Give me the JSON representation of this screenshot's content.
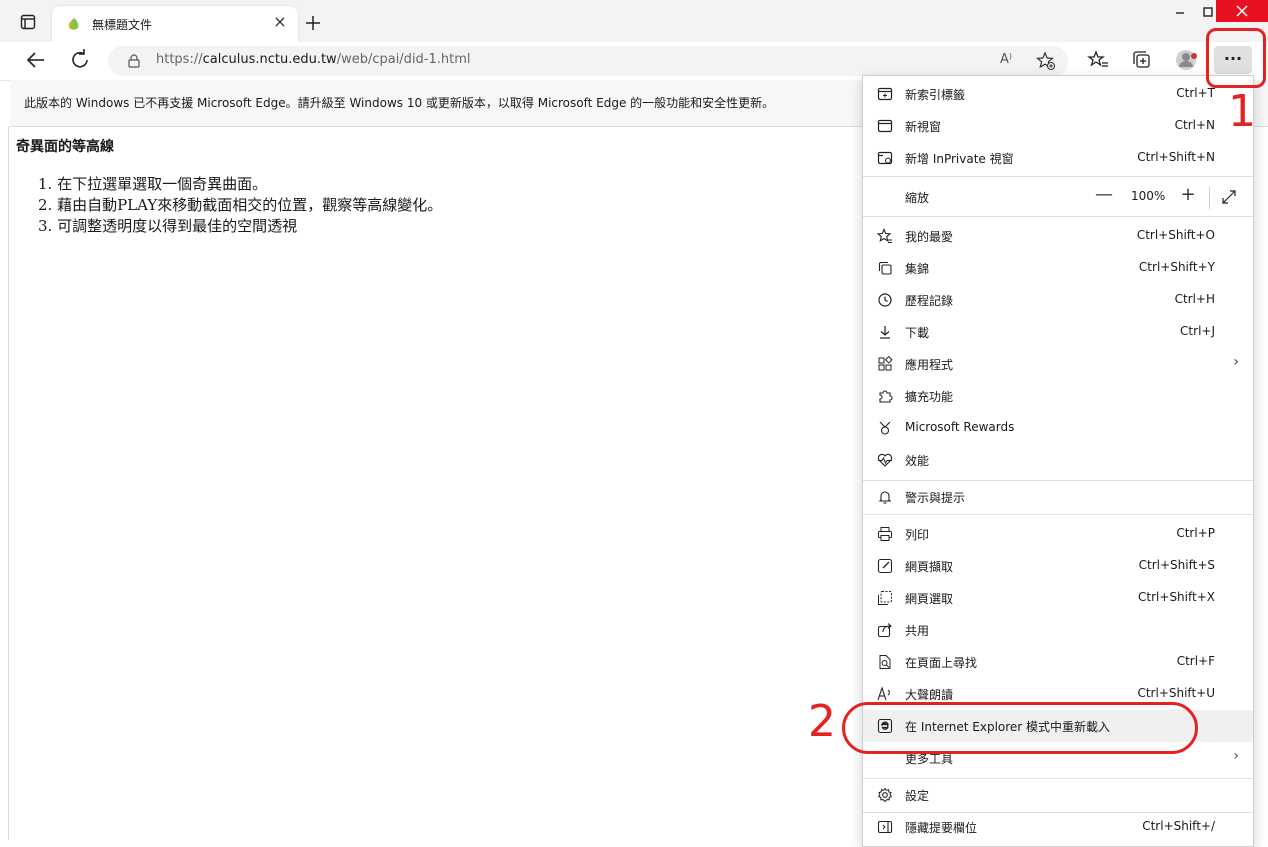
{
  "tab": {
    "title": "無標題文件",
    "close_glyph": "×"
  },
  "window": {
    "minimize_glyph": "−",
    "maximize_glyph": "□",
    "close_glyph": "✕"
  },
  "address": {
    "url_prefix": "https://",
    "url_domain": "calculus.nctu.edu.tw",
    "url_path": "/web/cpai/did-1.html",
    "read_aloud_glyph": "A⁾"
  },
  "menu_button": {
    "glyph": "···"
  },
  "infobar": {
    "text": "此版本的 Windows 已不再支援 Microsoft Edge。請升級至 Windows 10 或更新版本，以取得 Microsoft Edge 的一般功能和安全性更新。"
  },
  "page": {
    "heading": "奇異面的等高線",
    "steps": [
      "1. 在下拉選單選取一個奇異曲面。",
      "2. 藉由自動PLAY來移動截面相交的位置，觀察等高線變化。",
      "3. 可調整透明度以得到最佳的空間透視"
    ]
  },
  "menu": {
    "items": [
      {
        "label": "新索引標籤",
        "shortcut": "Ctrl+T"
      },
      {
        "label": "新視窗",
        "shortcut": "Ctrl+N"
      },
      {
        "label": "新增 InPrivate 視窗",
        "shortcut": "Ctrl+Shift+N"
      },
      {
        "label": "縮放",
        "zoom_value": "100%",
        "minus": "—",
        "plus": "+"
      },
      {
        "label": "我的最愛",
        "shortcut": "Ctrl+Shift+O"
      },
      {
        "label": "集錦",
        "shortcut": "Ctrl+Shift+Y"
      },
      {
        "label": "歷程記錄",
        "shortcut": "Ctrl+H"
      },
      {
        "label": "下載",
        "shortcut": "Ctrl+J"
      },
      {
        "label": "應用程式",
        "chevron": "›"
      },
      {
        "label": "擴充功能"
      },
      {
        "label": "Microsoft Rewards"
      },
      {
        "label": "效能"
      },
      {
        "label": "警示與提示"
      },
      {
        "label": "列印",
        "shortcut": "Ctrl+P"
      },
      {
        "label": "網頁擷取",
        "shortcut": "Ctrl+Shift+S"
      },
      {
        "label": "網頁選取",
        "shortcut": "Ctrl+Shift+X"
      },
      {
        "label": "共用"
      },
      {
        "label": "在頁面上尋找",
        "shortcut": "Ctrl+F"
      },
      {
        "label": "大聲朗讀",
        "shortcut": "Ctrl+Shift+U"
      },
      {
        "label": "在 Internet Explorer 模式中重新載入"
      },
      {
        "label": "更多工具",
        "chevron": "›"
      },
      {
        "label": "設定"
      },
      {
        "label": "隱藏提要欄位",
        "shortcut": "Ctrl+Shift+/"
      }
    ]
  },
  "annotations": {
    "step1": "1",
    "step2": "2"
  },
  "colors": {
    "annotation_red": "#e52222",
    "close_red": "#e81123",
    "highlight": "#f0f0f0"
  }
}
